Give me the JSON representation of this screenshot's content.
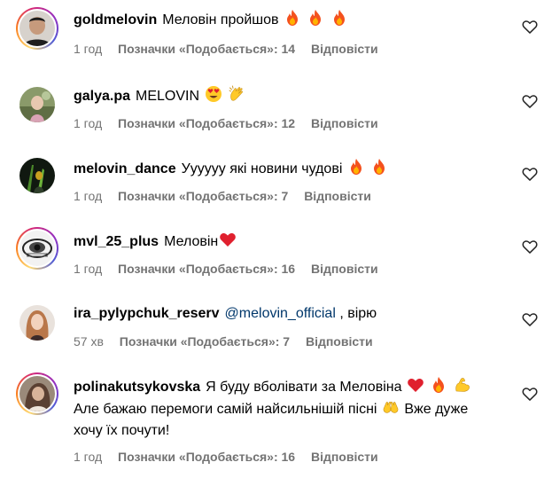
{
  "comments": [
    {
      "username": "goldmelovin",
      "text": "Меловін пройшов",
      "emoji": [
        "fire-icon",
        "fire-icon",
        "fire-icon"
      ],
      "time": "1 год",
      "likes": "Позначки «Подобається»: 14",
      "reply": "Відповісти"
    },
    {
      "username": "galya.pa",
      "text": "MELOVIN",
      "emoji": [
        "heart-eyes-icon",
        "clap-icon"
      ],
      "time": "1 год",
      "likes": "Позначки «Подобається»: 12",
      "reply": "Відповісти"
    },
    {
      "username": "melovin_dance",
      "text": "Уууууу які новини чудові",
      "emoji": [
        "fire-icon",
        "fire-icon"
      ],
      "time": "1 год",
      "likes": "Позначки «Подобається»: 7",
      "reply": "Відповісти"
    },
    {
      "username": "mvl_25_plus",
      "text": "Меловін",
      "emoji": [
        "red-heart-icon"
      ],
      "time": "1 год",
      "likes": "Позначки «Подобається»: 16",
      "reply": "Відповісти"
    },
    {
      "username": "ira_pylypchuk_reserv",
      "mention": "@melovin_official",
      "text": " , вірю",
      "time": "57 хв",
      "likes": "Позначки «Подобається»: 7",
      "reply": "Відповісти"
    },
    {
      "username": "polinakutsykovska",
      "text_a": "Я буду вболівати за Меловіна",
      "text_b": "Але бажаю перемоги самій найсильнішій пісні",
      "text_c": "Вже дуже хочу їх почути!",
      "time": "1 год",
      "likes": "Позначки «Подобається»: 16",
      "reply": "Відповісти"
    }
  ],
  "colors": {
    "text": "#000000",
    "meta": "#737373",
    "mention": "#00376b",
    "story_ring": [
      "#feda75",
      "#fa7e1e",
      "#d62976",
      "#962fbf",
      "#4f5bd5"
    ]
  }
}
